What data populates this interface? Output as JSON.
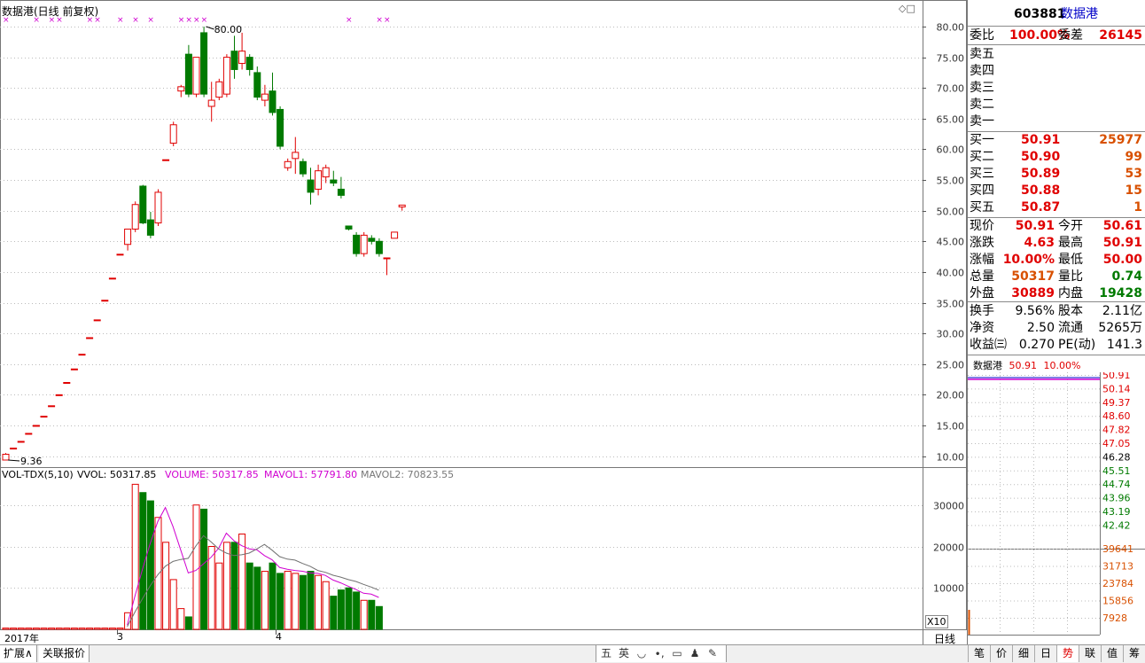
{
  "chart": {
    "title": "数据港(日线 前复权)",
    "high_label": "80.00",
    "low_label": "9.36",
    "price_ticks": [
      "80.00",
      "75.00",
      "70.00",
      "65.00",
      "60.00",
      "55.00",
      "50.00",
      "45.00",
      "40.00",
      "35.00",
      "30.00",
      "25.00",
      "20.00",
      "15.00",
      "10.00"
    ],
    "vol_header": {
      "name": "VOL-TDX(5,10)",
      "vvol": "VVOL: 50317.85",
      "volume": "VOLUME: 50317.85",
      "mavol1": "MAVOL1: 57791.80",
      "mavol2": "MAVOL2: 70823.55"
    },
    "vol_ticks": [
      "30000",
      "20000",
      "10000"
    ],
    "vol_unit": "X10",
    "date_labels": [
      "2017年",
      "3",
      "4"
    ],
    "period_label": "日线",
    "colors": {
      "up": "#e00000",
      "down": "#007a00",
      "ma1": "#d000d0",
      "ma2": "#707070",
      "marker": "#d000d0"
    }
  },
  "chart_data": {
    "type": "candlestick",
    "ylim": [
      7,
      82
    ],
    "candles": [
      {
        "o": 9.36,
        "h": 10.5,
        "l": 9.36,
        "c": 10.3
      },
      {
        "o": 11.3,
        "h": 11.3,
        "l": 11.3,
        "c": 11.3
      },
      {
        "o": 12.4,
        "h": 12.4,
        "l": 12.4,
        "c": 12.4
      },
      {
        "o": 13.7,
        "h": 13.7,
        "l": 13.7,
        "c": 13.7
      },
      {
        "o": 15.0,
        "h": 15.0,
        "l": 15.0,
        "c": 15.0
      },
      {
        "o": 16.5,
        "h": 16.5,
        "l": 16.5,
        "c": 16.5
      },
      {
        "o": 18.2,
        "h": 18.2,
        "l": 18.2,
        "c": 18.2
      },
      {
        "o": 20.0,
        "h": 20.0,
        "l": 20.0,
        "c": 20.0
      },
      {
        "o": 22.0,
        "h": 22.0,
        "l": 22.0,
        "c": 22.0
      },
      {
        "o": 24.2,
        "h": 24.2,
        "l": 24.2,
        "c": 24.2
      },
      {
        "o": 26.6,
        "h": 26.6,
        "l": 26.6,
        "c": 26.6
      },
      {
        "o": 29.3,
        "h": 29.3,
        "l": 29.3,
        "c": 29.3
      },
      {
        "o": 32.2,
        "h": 32.2,
        "l": 32.2,
        "c": 32.2
      },
      {
        "o": 35.4,
        "h": 35.4,
        "l": 35.4,
        "c": 35.4
      },
      {
        "o": 39.0,
        "h": 39.0,
        "l": 39.0,
        "c": 39.0
      },
      {
        "o": 42.9,
        "h": 42.9,
        "l": 42.9,
        "c": 42.9
      },
      {
        "o": 44.5,
        "h": 47.0,
        "l": 43.5,
        "c": 47.0
      },
      {
        "o": 47.0,
        "h": 51.5,
        "l": 46.5,
        "c": 51.0
      },
      {
        "o": 54.0,
        "h": 54.2,
        "l": 47.8,
        "c": 48.0
      },
      {
        "o": 48.5,
        "h": 49.8,
        "l": 45.5,
        "c": 46.0
      },
      {
        "o": 48.0,
        "h": 53.5,
        "l": 47.5,
        "c": 53.0
      },
      {
        "o": 58.3,
        "h": 58.3,
        "l": 58.3,
        "c": 58.3
      },
      {
        "o": 61.0,
        "h": 64.5,
        "l": 60.5,
        "c": 64.0
      },
      {
        "o": 69.5,
        "h": 70.5,
        "l": 68.5,
        "c": 70.2
      },
      {
        "o": 75.5,
        "h": 77.0,
        "l": 68.5,
        "c": 69.0
      },
      {
        "o": 69.0,
        "h": 75.0,
        "l": 68.5,
        "c": 75.0
      },
      {
        "o": 79.0,
        "h": 80.0,
        "l": 68.5,
        "c": 69.0
      },
      {
        "o": 67.0,
        "h": 71.0,
        "l": 64.5,
        "c": 68.0
      },
      {
        "o": 68.5,
        "h": 71.5,
        "l": 68.0,
        "c": 71.0
      },
      {
        "o": 69.0,
        "h": 75.5,
        "l": 68.5,
        "c": 75.0
      },
      {
        "o": 76.0,
        "h": 78.5,
        "l": 71.5,
        "c": 73.0
      },
      {
        "o": 74.0,
        "h": 79.0,
        "l": 73.0,
        "c": 76.0
      },
      {
        "o": 75.0,
        "h": 75.5,
        "l": 72.0,
        "c": 73.0
      },
      {
        "o": 72.5,
        "h": 73.5,
        "l": 68.0,
        "c": 68.5
      },
      {
        "o": 68.0,
        "h": 70.5,
        "l": 67.0,
        "c": 69.0
      },
      {
        "o": 69.5,
        "h": 72.5,
        "l": 65.5,
        "c": 66.0
      },
      {
        "o": 66.5,
        "h": 67.0,
        "l": 60.0,
        "c": 60.5
      },
      {
        "o": 57.0,
        "h": 58.5,
        "l": 56.5,
        "c": 58.0
      },
      {
        "o": 58.5,
        "h": 62.0,
        "l": 56.0,
        "c": 59.5
      },
      {
        "o": 58.0,
        "h": 58.5,
        "l": 55.5,
        "c": 56.0
      },
      {
        "o": 55.0,
        "h": 57.0,
        "l": 51.0,
        "c": 53.0
      },
      {
        "o": 53.5,
        "h": 57.5,
        "l": 52.5,
        "c": 56.5
      },
      {
        "o": 55.5,
        "h": 57.5,
        "l": 54.5,
        "c": 57.0
      },
      {
        "o": 55.0,
        "h": 56.5,
        "l": 54.0,
        "c": 54.5
      },
      {
        "o": 53.5,
        "h": 55.5,
        "l": 52.0,
        "c": 52.5
      },
      {
        "o": 47.5,
        "h": 47.5,
        "l": 46.8,
        "c": 47.0
      },
      {
        "o": 46.0,
        "h": 46.5,
        "l": 42.5,
        "c": 43.0
      },
      {
        "o": 43.0,
        "h": 46.5,
        "l": 42.5,
        "c": 46.0
      },
      {
        "o": 45.5,
        "h": 46.0,
        "l": 44.5,
        "c": 45.0
      },
      {
        "o": 45.0,
        "h": 45.5,
        "l": 42.5,
        "c": 43.0
      },
      {
        "o": 42.3,
        "h": 42.3,
        "l": 39.5,
        "c": 42.3
      },
      {
        "o": 45.5,
        "h": 46.5,
        "l": 45.5,
        "c": 46.5
      },
      {
        "o": 50.61,
        "h": 50.91,
        "l": 50.0,
        "c": 50.91
      }
    ],
    "volumes": [
      300,
      300,
      300,
      300,
      300,
      300,
      300,
      300,
      300,
      300,
      300,
      300,
      300,
      300,
      300,
      300,
      4000,
      35000,
      33000,
      31000,
      27000,
      21000,
      12000,
      5000,
      3000,
      30000,
      29000,
      20000,
      16000,
      21000,
      21000,
      23000,
      16000,
      15000,
      14000,
      16000,
      13500,
      14000,
      13500,
      13000,
      14000,
      13000,
      11500,
      8000,
      9500,
      10000,
      9000,
      7000,
      7000,
      5500
    ],
    "volume_ylim": [
      0,
      40000
    ],
    "markers_count": 17
  },
  "quote": {
    "code": "603881",
    "name": "数据港",
    "wei_bi_label": "委比",
    "wei_bi": "100.00%",
    "wei_cha_label": "委差",
    "wei_cha": "26145",
    "sell": [
      {
        "label": "卖五"
      },
      {
        "label": "卖四"
      },
      {
        "label": "卖三"
      },
      {
        "label": "卖二"
      },
      {
        "label": "卖一"
      }
    ],
    "buy": [
      {
        "label": "买一",
        "price": "50.91",
        "vol": "25977"
      },
      {
        "label": "买二",
        "price": "50.90",
        "vol": "99"
      },
      {
        "label": "买三",
        "price": "50.89",
        "vol": "53"
      },
      {
        "label": "买四",
        "price": "50.88",
        "vol": "15"
      },
      {
        "label": "买五",
        "price": "50.87",
        "vol": "1"
      }
    ],
    "stats": [
      {
        "l1": "现价",
        "v1": "50.91",
        "c1": "red",
        "l2": "今开",
        "v2": "50.61",
        "c2": "red"
      },
      {
        "l1": "涨跌",
        "v1": "4.63",
        "c1": "red",
        "l2": "最高",
        "v2": "50.91",
        "c2": "red"
      },
      {
        "l1": "涨幅",
        "v1": "10.00%",
        "c1": "red",
        "l2": "最低",
        "v2": "50.00",
        "c2": "red"
      },
      {
        "l1": "总量",
        "v1": "50317",
        "c1": "orange",
        "l2": "量比",
        "v2": "0.74",
        "c2": "green"
      },
      {
        "l1": "外盘",
        "v1": "30889",
        "c1": "red",
        "l2": "内盘",
        "v2": "19428",
        "c2": "green"
      }
    ],
    "fund": [
      {
        "l1": "换手",
        "v1": "9.56%",
        "l2": "股本",
        "v2": "2.11亿"
      },
      {
        "l1": "净资",
        "v1": "2.50",
        "l2": "流通",
        "v2": "5265万"
      },
      {
        "l1": "收益㈢",
        "v1": "0.270",
        "l2": "PE(动)",
        "v2": "141.3"
      }
    ]
  },
  "mini": {
    "title_name": "数据港",
    "title_price": "50.91",
    "title_pct": "10.00%",
    "price_ticks": [
      "50.91",
      "50.14",
      "49.37",
      "48.60",
      "47.82",
      "47.05",
      "46.28",
      "45.51",
      "44.74",
      "43.96",
      "43.19",
      "42.42"
    ],
    "vol_ticks": [
      "39641",
      "31713",
      "23784",
      "15856",
      "7928"
    ]
  },
  "bottom": {
    "tabs": [
      "扩展∧",
      "关联报价"
    ],
    "icons": [
      {
        "glyph": "五",
        "name": "five-level-icon"
      },
      {
        "glyph": "英",
        "name": "english-input-icon"
      },
      {
        "glyph": "◡",
        "name": "moon-icon"
      },
      {
        "glyph": "∙,",
        "name": "punctuation-icon"
      },
      {
        "glyph": "▭",
        "name": "keyboard-icon"
      },
      {
        "glyph": "♟",
        "name": "user-icon"
      },
      {
        "glyph": "✎",
        "name": "wrench-icon"
      }
    ],
    "right_tabs": [
      "笔",
      "价",
      "细",
      "日",
      "势",
      "联",
      "值",
      "筹"
    ]
  }
}
